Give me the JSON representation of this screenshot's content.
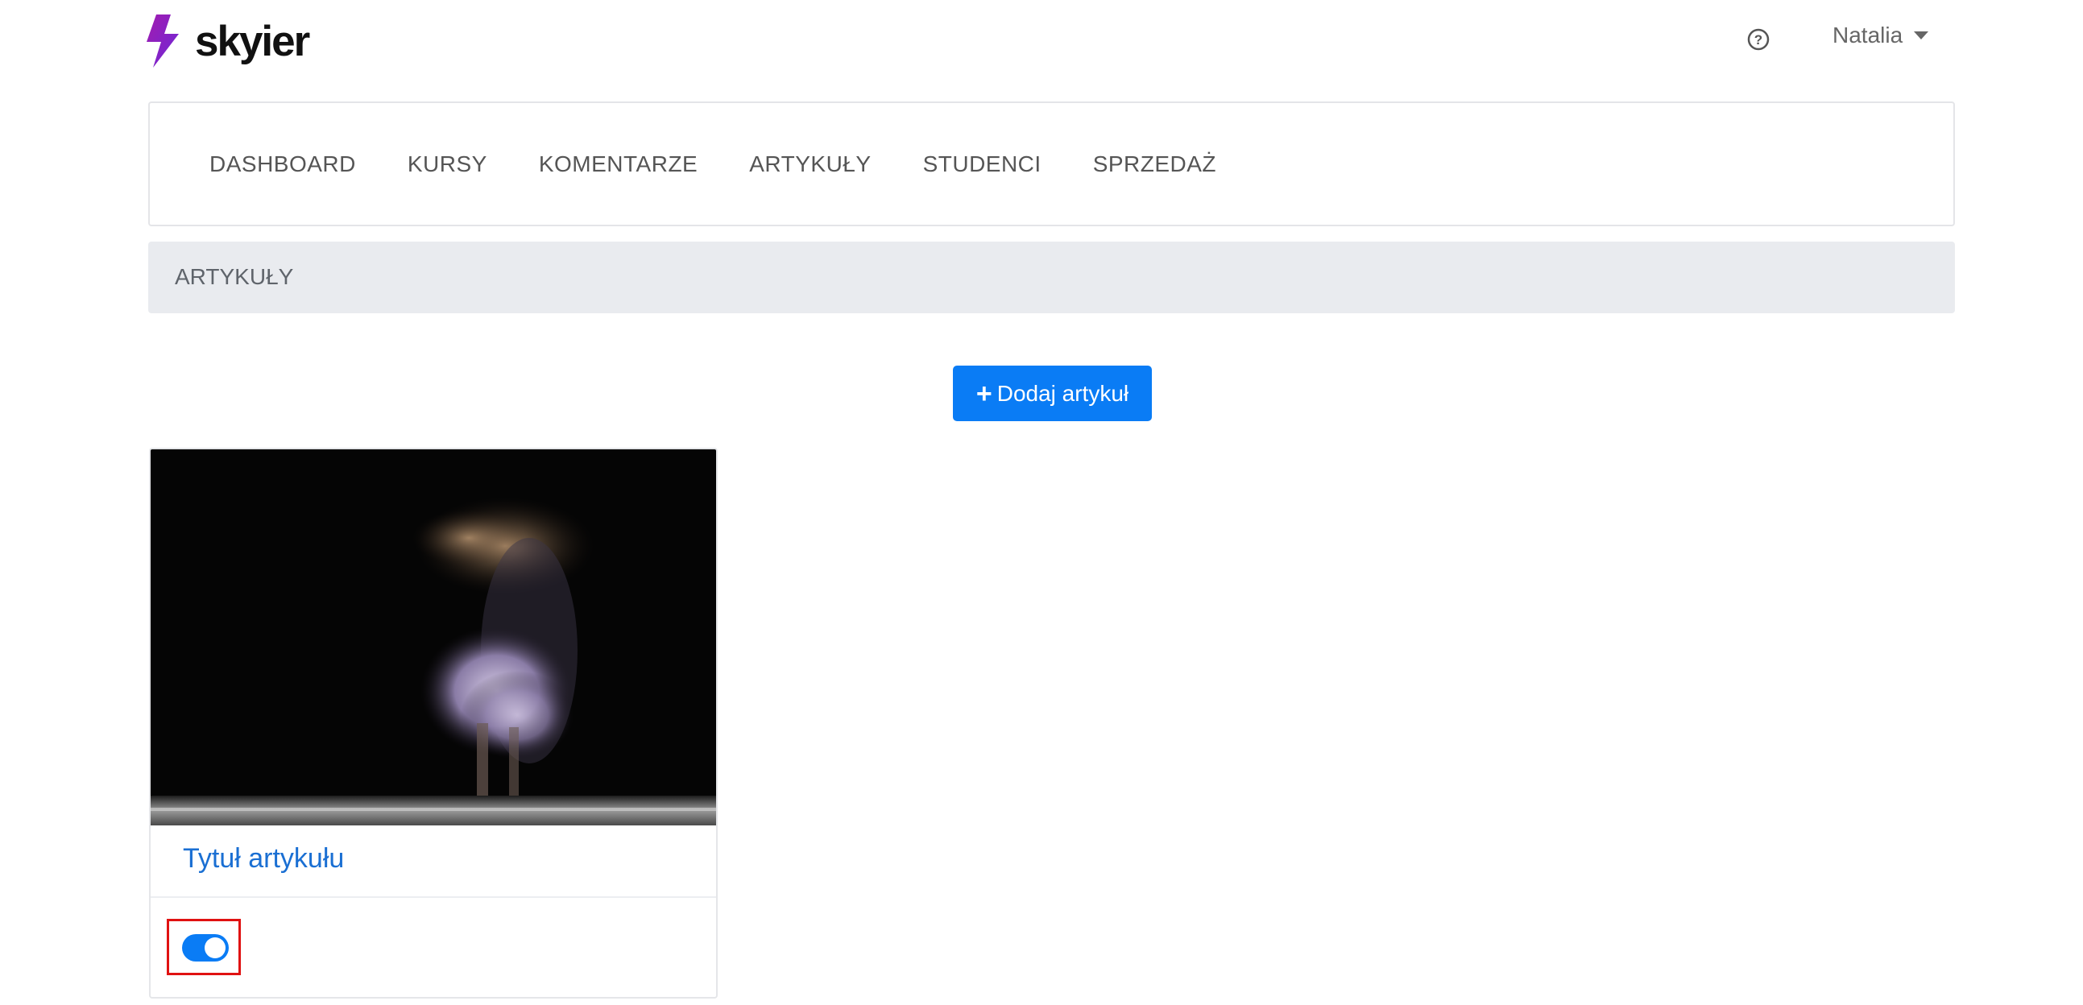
{
  "brand": {
    "name": "skyier"
  },
  "header": {
    "help_icon": "question-circle-icon",
    "user_name": "Natalia",
    "user_caret_icon": "caret-down-icon"
  },
  "nav": {
    "items": [
      "DASHBOARD",
      "KURSY",
      "KOMENTARZE",
      "ARTYKUŁY",
      "STUDENCI",
      "SPRZEDAŻ"
    ]
  },
  "breadcrumb": {
    "label": "ARTYKUŁY"
  },
  "actions": {
    "add_label": "Dodaj artykuł",
    "add_icon": "plus-icon"
  },
  "articles": [
    {
      "title": "Tytuł artykułu",
      "published": true,
      "image": "dancer-photo"
    }
  ],
  "colors": {
    "primary": "#0a7cf5",
    "link": "#1a6fd3",
    "highlight": "#e01212"
  }
}
